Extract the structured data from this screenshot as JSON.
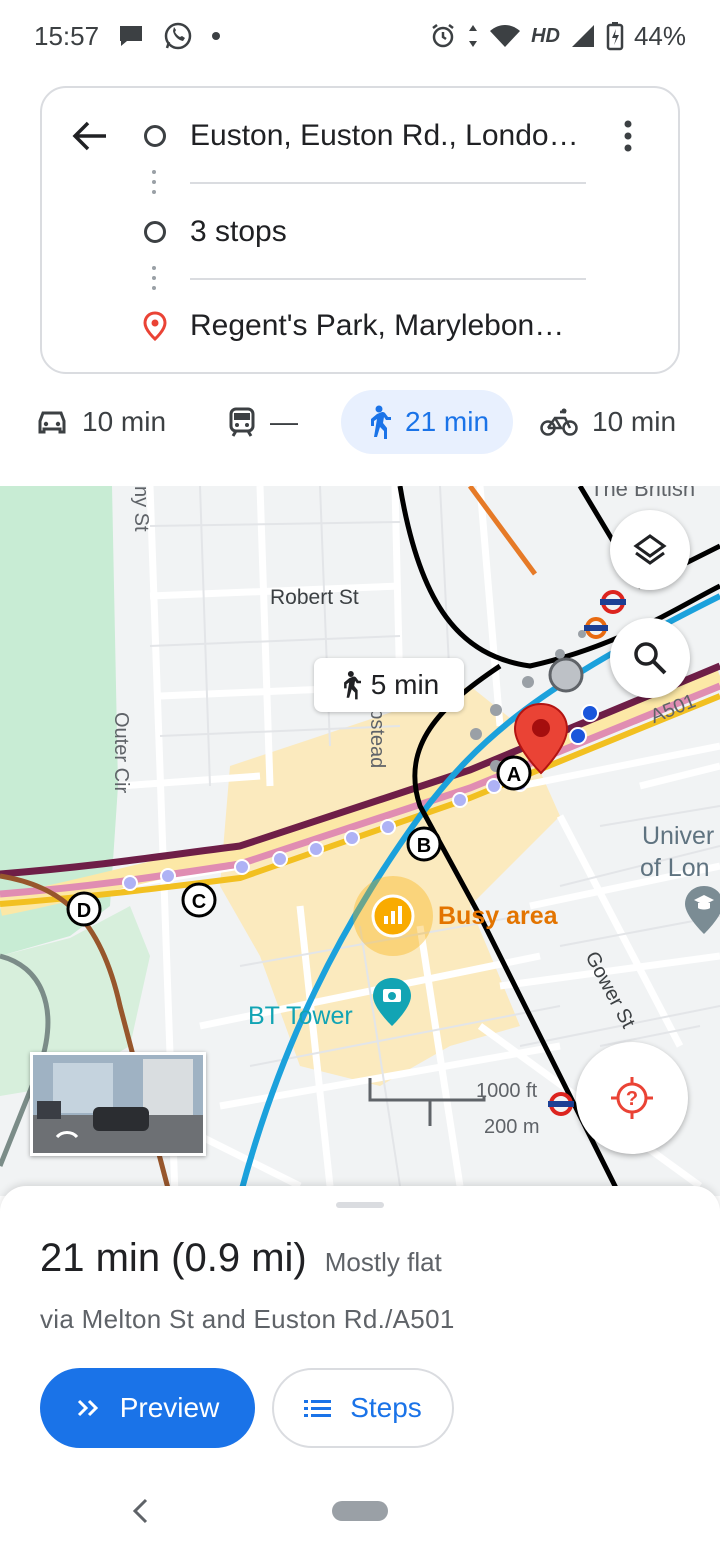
{
  "status_bar": {
    "time": "15:57",
    "hd_label": "HD",
    "battery": "44%"
  },
  "route": {
    "origin": "Euston, Euston Rd., Londo…",
    "stops": "3 stops",
    "destination": "Regent's Park, Marylebon…"
  },
  "modes": {
    "drive": "10 min",
    "transit": "—",
    "walk": "21 min",
    "bike": "10 min",
    "selected": "walk"
  },
  "map": {
    "walk_chip": "5 min",
    "labels": {
      "robert_st": "Robert St",
      "hampstead": "Hampstead",
      "outer_cir": "Outer Cir",
      "a501": "A501",
      "gower_st": "Gower St",
      "univ_1": "Univer",
      "univ_2": "of Lon",
      "british": "The British",
      "ny_st": "ny St"
    },
    "busy_label": "Busy area",
    "poi_label": "BT Tower",
    "waypoints": [
      "A",
      "B",
      "C",
      "D"
    ],
    "scale_ft": "1000 ft",
    "scale_m": "200 m",
    "colors": {
      "route_dots": "#aeb2f5",
      "destination_pin": "#ea4335",
      "busy": "#f9ab00",
      "poi": "#12a4b4",
      "park": "#c8ecd4"
    }
  },
  "sheet": {
    "time_distance": "21 min (0.9 mi)",
    "terrain": "Mostly flat",
    "via": "via Melton St and Euston Rd./A501",
    "preview_label": "Preview",
    "steps_label": "Steps"
  }
}
